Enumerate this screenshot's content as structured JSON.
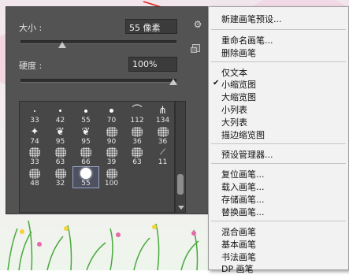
{
  "panel": {
    "size_label": "大小 :",
    "size_value": "55 像素",
    "hardness_label": "硬度 :",
    "hardness_value": "100%"
  },
  "brushes": [
    {
      "size": "33",
      "kind": "dot"
    },
    {
      "size": "42",
      "kind": "dot"
    },
    {
      "size": "55",
      "kind": "dot"
    },
    {
      "size": "70",
      "kind": "dot"
    },
    {
      "size": "112",
      "kind": "curve"
    },
    {
      "size": "134",
      "kind": "grass"
    },
    {
      "size": "74",
      "kind": "star"
    },
    {
      "size": "95",
      "kind": "leaf"
    },
    {
      "size": "95",
      "kind": "leaf"
    },
    {
      "size": "90",
      "kind": "rough"
    },
    {
      "size": "36",
      "kind": "rough"
    },
    {
      "size": "36",
      "kind": "rough"
    },
    {
      "size": "33",
      "kind": "rough"
    },
    {
      "size": "63",
      "kind": "rough"
    },
    {
      "size": "66",
      "kind": "rough"
    },
    {
      "size": "39",
      "kind": "rough"
    },
    {
      "size": "63",
      "kind": "rough"
    },
    {
      "size": "11",
      "kind": "streak"
    },
    {
      "size": "48",
      "kind": "rough"
    },
    {
      "size": "32",
      "kind": "rough"
    },
    {
      "size": "55",
      "kind": "soft"
    },
    {
      "size": "100",
      "kind": "rough"
    }
  ],
  "menu": {
    "new_preset": "新建画笔预设...",
    "rename": "重命名画笔...",
    "delete": "删除画笔",
    "text_only": "仅文本",
    "small_thumb": "小缩览图",
    "large_thumb": "大缩览图",
    "small_list": "小列表",
    "large_list": "大列表",
    "stroke_thumb": "描边缩览图",
    "preset_manager": "预设管理器...",
    "reset": "复位画笔...",
    "load": "载入画笔...",
    "save": "存储画笔...",
    "replace": "替换画笔...",
    "mixer": "混合画笔",
    "basic": "基本画笔",
    "calligraphic": "书法画笔",
    "dp": "DP 画笔"
  },
  "slider_levels": {
    "size": 0.26,
    "hardness": 1.0
  },
  "colors": {
    "panel": "#535353",
    "menu": "#f2f2f2",
    "annotation_arrow": "#e02020"
  },
  "icons": {
    "gear": "gear-icon",
    "new_preset": "new-preset-icon",
    "checkmark": "check-icon"
  }
}
